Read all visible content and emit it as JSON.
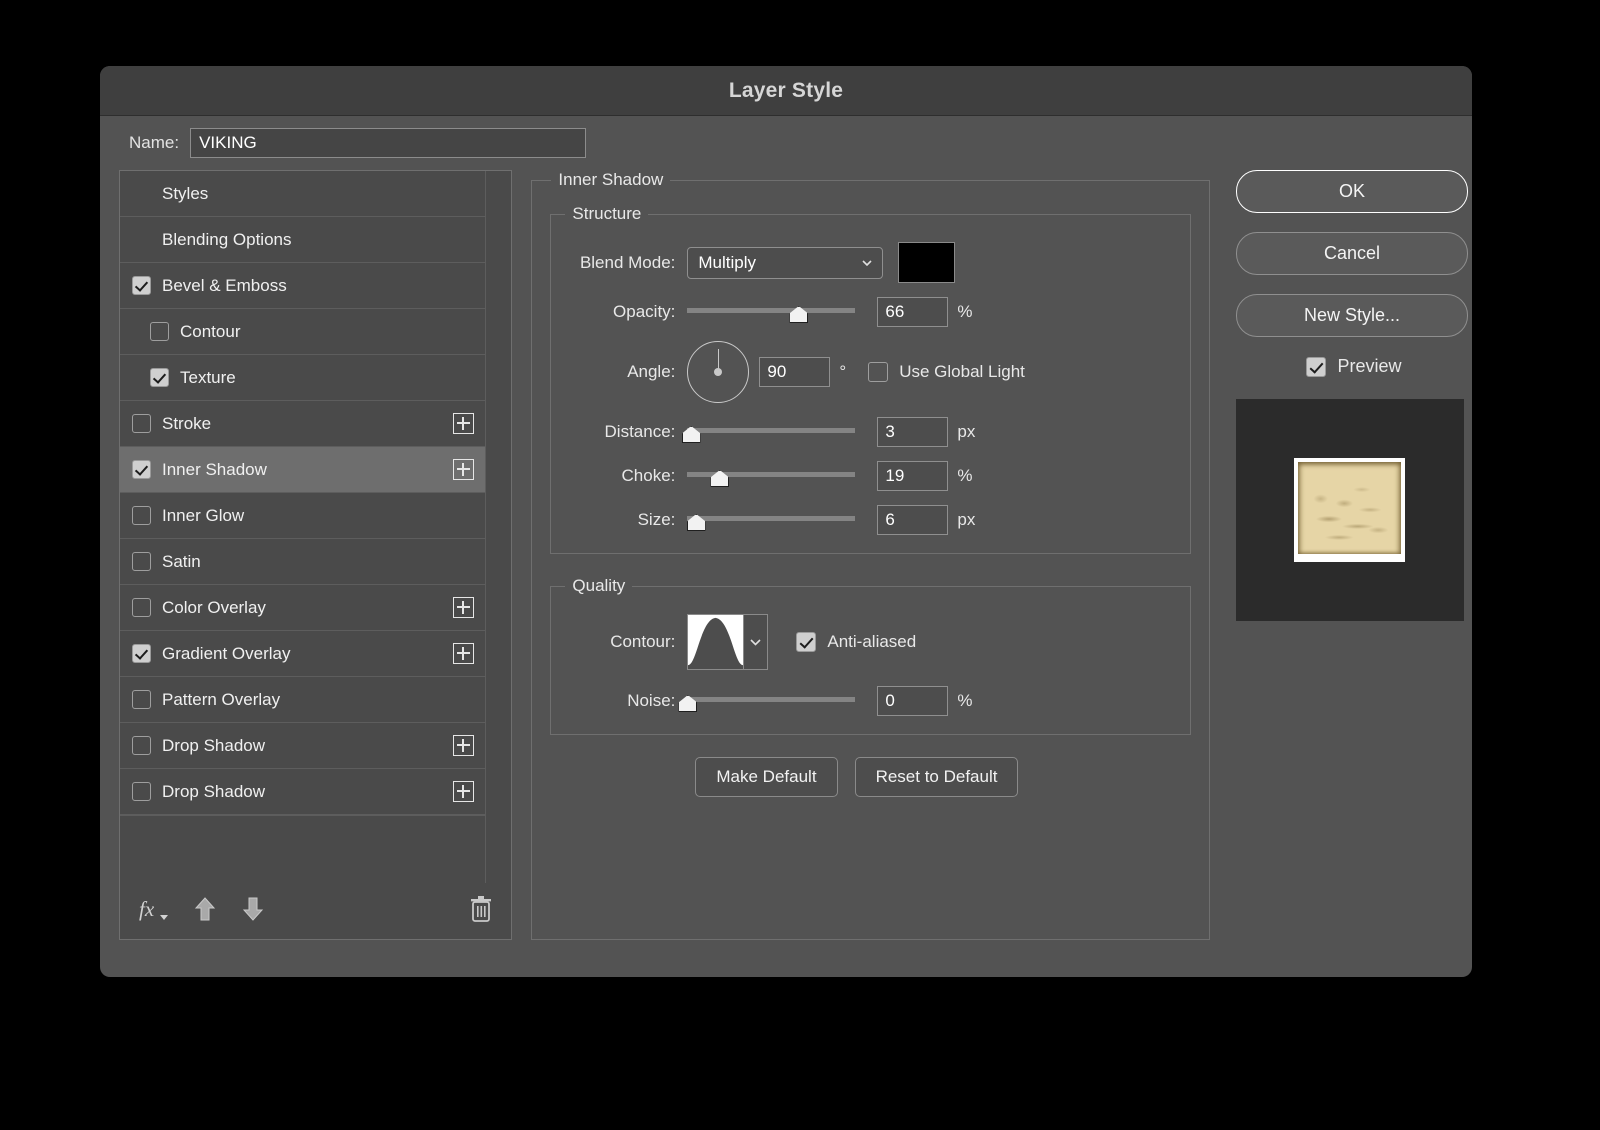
{
  "window": {
    "title": "Layer Style"
  },
  "name_row": {
    "label": "Name:",
    "value": "VIKING"
  },
  "effects": {
    "items": [
      {
        "label": "Styles",
        "checkbox": "none",
        "indent": false,
        "plus": false,
        "selected": false
      },
      {
        "label": "Blending Options",
        "checkbox": "none",
        "indent": false,
        "plus": false,
        "selected": false
      },
      {
        "label": "Bevel & Emboss",
        "checkbox": "checked",
        "indent": false,
        "plus": false,
        "selected": false
      },
      {
        "label": "Contour",
        "checkbox": "empty",
        "indent": true,
        "plus": false,
        "selected": false
      },
      {
        "label": "Texture",
        "checkbox": "checked",
        "indent": true,
        "plus": false,
        "selected": false
      },
      {
        "label": "Stroke",
        "checkbox": "empty",
        "indent": false,
        "plus": true,
        "selected": false
      },
      {
        "label": "Inner Shadow",
        "checkbox": "checked",
        "indent": false,
        "plus": true,
        "selected": true
      },
      {
        "label": "Inner Glow",
        "checkbox": "empty",
        "indent": false,
        "plus": false,
        "selected": false
      },
      {
        "label": "Satin",
        "checkbox": "empty",
        "indent": false,
        "plus": false,
        "selected": false
      },
      {
        "label": "Color Overlay",
        "checkbox": "empty",
        "indent": false,
        "plus": true,
        "selected": false
      },
      {
        "label": "Gradient Overlay",
        "checkbox": "checked",
        "indent": false,
        "plus": true,
        "selected": false
      },
      {
        "label": "Pattern Overlay",
        "checkbox": "empty",
        "indent": false,
        "plus": false,
        "selected": false
      },
      {
        "label": "Drop Shadow",
        "checkbox": "empty",
        "indent": false,
        "plus": true,
        "selected": false
      },
      {
        "label": "Drop Shadow",
        "checkbox": "empty",
        "indent": false,
        "plus": true,
        "selected": false
      }
    ],
    "toolbar": {
      "fx_icon": "fx-icon",
      "move_up_icon": "arrow-up-icon",
      "move_down_icon": "arrow-down-icon",
      "delete_icon": "trash-icon"
    }
  },
  "panel": {
    "title": "Inner Shadow",
    "structure": {
      "legend": "Structure",
      "blend_mode": {
        "label": "Blend Mode:",
        "value": "Multiply",
        "color": "#000000"
      },
      "opacity": {
        "label": "Opacity:",
        "value": "66",
        "unit": "%",
        "percent": 66
      },
      "angle": {
        "label": "Angle:",
        "value": "90",
        "unit": "°",
        "global_light_label": "Use Global Light",
        "global_light_checked": false
      },
      "distance": {
        "label": "Distance:",
        "value": "3",
        "unit": "px",
        "percent": 2
      },
      "choke": {
        "label": "Choke:",
        "value": "19",
        "unit": "%",
        "percent": 19
      },
      "size": {
        "label": "Size:",
        "value": "6",
        "unit": "px",
        "percent": 5
      }
    },
    "quality": {
      "legend": "Quality",
      "contour": {
        "label": "Contour:",
        "shape": "gaussian-dome",
        "anti_aliased_label": "Anti-aliased",
        "anti_aliased_checked": true
      },
      "noise": {
        "label": "Noise:",
        "value": "0",
        "unit": "%",
        "percent": 0
      }
    },
    "buttons": {
      "make_default": "Make Default",
      "reset_to_default": "Reset to Default"
    }
  },
  "actions": {
    "ok": "OK",
    "cancel": "Cancel",
    "new_style": "New Style...",
    "preview_label": "Preview",
    "preview_checked": true
  },
  "colors": {
    "dialog_bg": "#535353",
    "titlebar_bg": "#3f3f3f",
    "panel_bg": "#4a4a4a",
    "selected_row": "#6e6e6e",
    "text": "#f0f0f0",
    "preview_bg": "#2b2b2b"
  }
}
